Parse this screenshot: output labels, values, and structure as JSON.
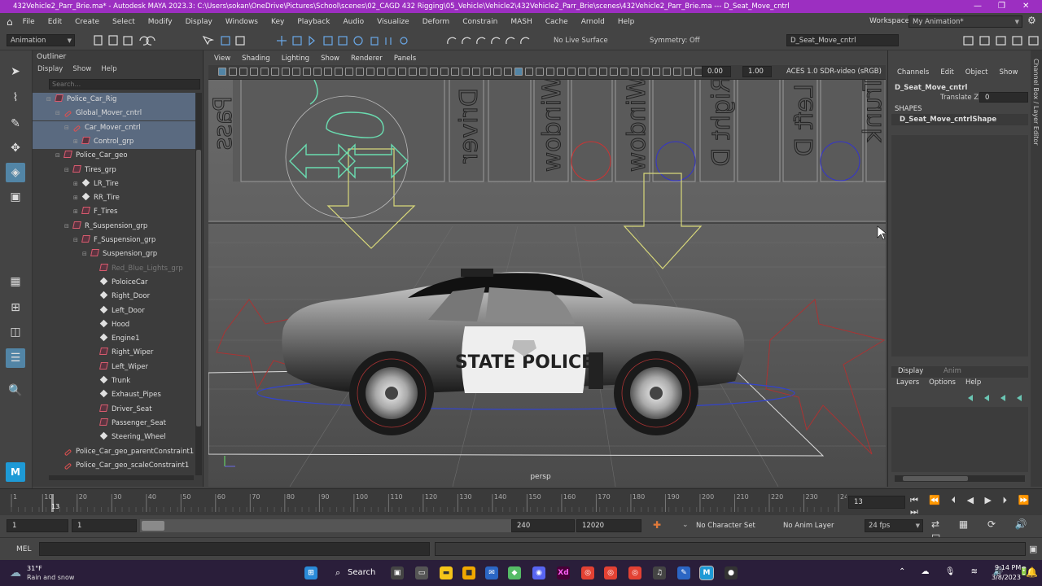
{
  "window": {
    "title": "432Vehicle2_Parr_Brie.ma* - Autodesk MAYA 2023.3: C:\\Users\\sokan\\OneDrive\\Pictures\\School\\scenes\\02_CAGD 432 Rigging\\05_Vehicle\\Vehicle2\\432Vehicle2_Parr_Brie\\scenes\\432Vehicle2_Parr_Brie.ma   ---   D_Seat_Move_cntrl",
    "minimize": "—",
    "maximize": "❐",
    "close": "✕"
  },
  "menubar": {
    "items": [
      "File",
      "Edit",
      "Create",
      "Select",
      "Modify",
      "Display",
      "Windows",
      "Key",
      "Playback",
      "Audio",
      "Visualize",
      "Deform",
      "Constrain",
      "MASH",
      "Cache",
      "Arnold",
      "Help"
    ],
    "workspace_label": "Workspace:",
    "workspace_value": "My Animation*"
  },
  "statusline": {
    "menuset": "Animation",
    "live_surface": "No Live Surface",
    "symmetry": "Symmetry: Off",
    "selected_object": "D_Seat_Move_cntrl"
  },
  "outliner": {
    "title": "Outliner",
    "menu": [
      "Display",
      "Show",
      "Help"
    ],
    "search_placeholder": "Search...",
    "rows": [
      {
        "label": "Police_Car_Rig",
        "icon": "group-icon",
        "indent": 1,
        "expand": "⊟",
        "selected": true
      },
      {
        "label": "Global_Mover_cntrl",
        "icon": "curve-icon",
        "indent": 2,
        "expand": "⊟",
        "selected": true
      },
      {
        "label": "Car_Mover_cntrl",
        "icon": "curve-icon",
        "indent": 3,
        "expand": "⊟",
        "selected": true
      },
      {
        "label": "Control_grp",
        "icon": "group-icon",
        "indent": 4,
        "expand": "⊞",
        "selected": true
      },
      {
        "label": "Police_Car_geo",
        "icon": "group-icon",
        "indent": 2,
        "expand": "⊟",
        "selected": false
      },
      {
        "label": "Tires_grp",
        "icon": "group-icon",
        "indent": 3,
        "expand": "⊟",
        "selected": false
      },
      {
        "label": "LR_Tire",
        "icon": "mesh-icon",
        "indent": 4,
        "expand": "⊞",
        "selected": false
      },
      {
        "label": "RR_Tire",
        "icon": "mesh-icon",
        "indent": 4,
        "expand": "⊞",
        "selected": false
      },
      {
        "label": "F_Tires",
        "icon": "group-icon",
        "indent": 4,
        "expand": "⊞",
        "selected": false
      },
      {
        "label": "R_Suspension_grp",
        "icon": "group-icon",
        "indent": 3,
        "expand": "⊟",
        "selected": false
      },
      {
        "label": "F_Suspension_grp",
        "icon": "group-icon",
        "indent": 4,
        "expand": "⊟",
        "selected": false
      },
      {
        "label": "Suspension_grp",
        "icon": "group-icon",
        "indent": 5,
        "expand": "⊟",
        "selected": false
      },
      {
        "label": "Red_Blue_Lights_grp",
        "icon": "group-icon",
        "indent": 6,
        "expand": "",
        "selected": false,
        "dim": true
      },
      {
        "label": "PoloiceCar",
        "icon": "mesh-icon",
        "indent": 6,
        "expand": "",
        "selected": false
      },
      {
        "label": "Right_Door",
        "icon": "mesh-icon",
        "indent": 6,
        "expand": "",
        "selected": false
      },
      {
        "label": "Left_Door",
        "icon": "mesh-icon",
        "indent": 6,
        "expand": "",
        "selected": false
      },
      {
        "label": "Hood",
        "icon": "mesh-icon",
        "indent": 6,
        "expand": "",
        "selected": false
      },
      {
        "label": "Engine1",
        "icon": "mesh-icon",
        "indent": 6,
        "expand": "",
        "selected": false
      },
      {
        "label": "Right_Wiper",
        "icon": "group-icon",
        "indent": 6,
        "expand": "",
        "selected": false
      },
      {
        "label": "Left_Wiper",
        "icon": "group-icon",
        "indent": 6,
        "expand": "",
        "selected": false
      },
      {
        "label": "Trunk",
        "icon": "mesh-icon",
        "indent": 6,
        "expand": "",
        "selected": false
      },
      {
        "label": "Exhaust_Pipes",
        "icon": "mesh-icon",
        "indent": 6,
        "expand": "",
        "selected": false
      },
      {
        "label": "Driver_Seat",
        "icon": "group-icon",
        "indent": 6,
        "expand": "",
        "selected": false
      },
      {
        "label": "Passenger_Seat",
        "icon": "group-icon",
        "indent": 6,
        "expand": "",
        "selected": false
      },
      {
        "label": "Steering_Wheel",
        "icon": "mesh-icon",
        "indent": 6,
        "expand": "",
        "selected": false
      },
      {
        "label": "Police_Car_geo_parentConstraint1",
        "icon": "curve-icon",
        "indent": 2,
        "expand": "",
        "selected": false
      },
      {
        "label": "Police_Car_geo_scaleConstraint1",
        "icon": "curve-icon",
        "indent": 2,
        "expand": "",
        "selected": false
      }
    ]
  },
  "viewport": {
    "menu": [
      "View",
      "Shading",
      "Lighting",
      "Show",
      "Renderer",
      "Panels"
    ],
    "exposure": "0.00",
    "gamma": "1.00",
    "color_space": "ACES 1.0 SDR-video (sRGB)",
    "camera_label": "persp",
    "car_text": "STATE POLICE",
    "mirrored_labels": [
      "Pass",
      "Driver",
      "Window",
      "Window",
      "Right D",
      "Left D",
      "Trunk"
    ]
  },
  "channelbox": {
    "menu": [
      "Channels",
      "Edit",
      "Object",
      "Show"
    ],
    "object_name": "D_Seat_Move_cntrl",
    "attr_name": "Translate Z",
    "attr_value": "0",
    "shapes_header": "SHAPES",
    "shape_name": "D_Seat_Move_cntrlShape",
    "layer_tabs": [
      "Display",
      "Anim"
    ],
    "layer_menu": [
      "Layers",
      "Options",
      "Help"
    ],
    "side_label": "Channel Box / Layer Editor"
  },
  "timeline": {
    "ticks": [
      "1",
      "10",
      "20",
      "30",
      "40",
      "50",
      "60",
      "70",
      "80",
      "90",
      "100",
      "110",
      "120",
      "130",
      "140",
      "150",
      "160",
      "170",
      "180",
      "190",
      "200",
      "210",
      "220",
      "230",
      "24"
    ],
    "current_frame_marker": "13",
    "current_frame_field": "13"
  },
  "range": {
    "start": "1",
    "playback_start": "1",
    "playback_end": "240",
    "end": "12020",
    "character_set": "No Character Set",
    "anim_layer": "No Anim Layer",
    "fps": "24 fps"
  },
  "mel": {
    "label": "MEL"
  },
  "taskbar": {
    "weather_temp": "31°F",
    "weather_desc": "Rain and snow",
    "search_label": "Search",
    "time": "9:14 PM",
    "date": "3/8/2023"
  }
}
